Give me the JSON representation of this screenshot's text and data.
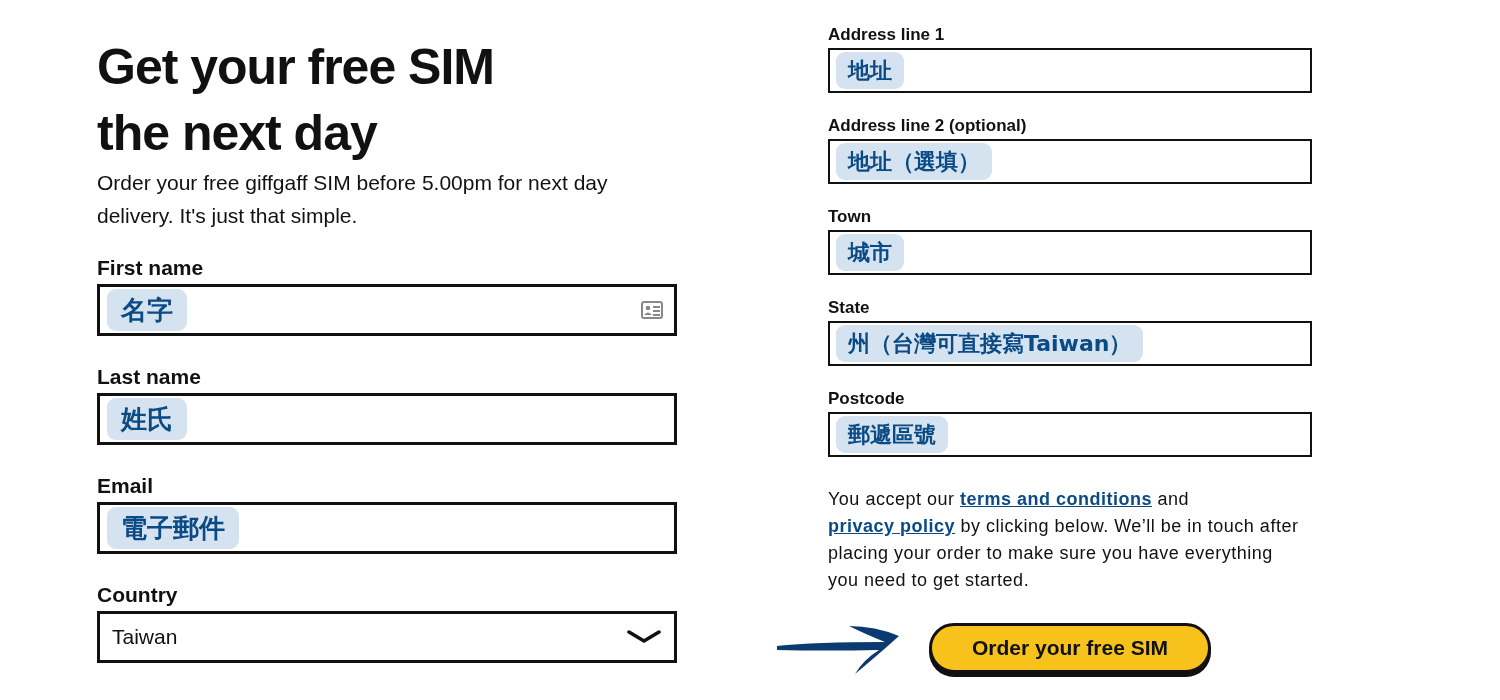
{
  "heading": [
    "Get your free SIM",
    "the next day"
  ],
  "intro": "Order your free giffgaff SIM before 5.00pm for next day delivery. It's just that simple.",
  "left_fields": [
    {
      "label": "First name",
      "value": "名字",
      "kind": "autofill"
    },
    {
      "label": "Last name",
      "value": "姓氏",
      "kind": "text"
    },
    {
      "label": "Email",
      "value": "電子郵件",
      "kind": "text"
    },
    {
      "label": "Country",
      "value": "Taiwan",
      "kind": "select"
    }
  ],
  "right_fields": [
    {
      "label": "Address line 1",
      "value": "地址"
    },
    {
      "label": "Address line 2 (optional)",
      "value": "地址（選填）"
    },
    {
      "label": "Town",
      "value": "城市"
    },
    {
      "label": "State",
      "value": "州（台灣可直接寫Taiwan）"
    },
    {
      "label": "Postcode",
      "value": "郵遞區號"
    }
  ],
  "consent": [
    {
      "text": "You accept our ",
      "kind": "text"
    },
    {
      "text": "terms and conditions",
      "kind": "link"
    },
    {
      "text": " and ",
      "kind": "text"
    },
    {
      "text": "privacy policy",
      "kind": "link"
    },
    {
      "text": " by clicking below. We’ll be in touch after placing your order to make sure you have everything you need to get started.",
      "kind": "text"
    }
  ],
  "submit": "Order your free SIM"
}
